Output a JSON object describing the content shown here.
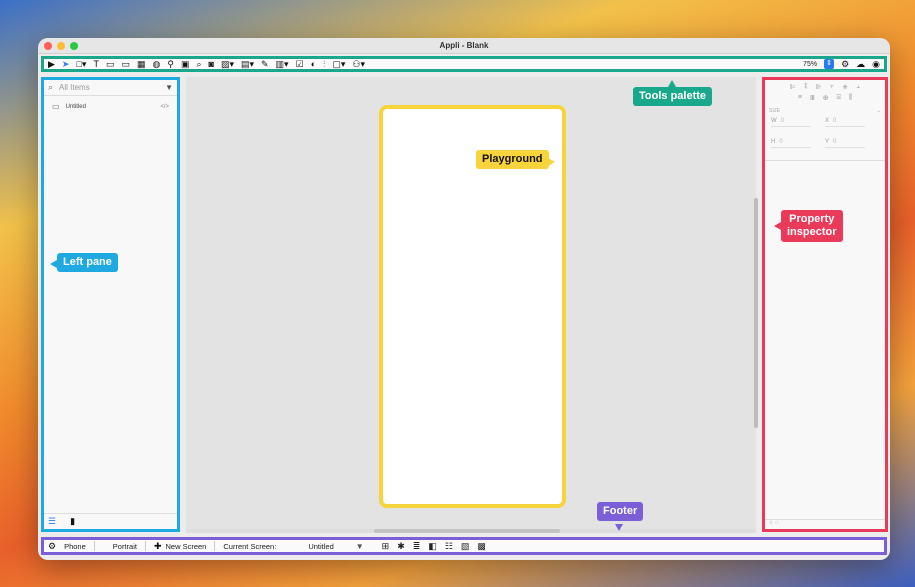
{
  "window": {
    "title": "Appli - Blank"
  },
  "toolbar": {
    "tools": [
      {
        "icon": "play-icon",
        "glyph": "▶"
      },
      {
        "icon": "pointer-icon",
        "glyph": "➤",
        "blue": true
      },
      {
        "icon": "rectangle-icon",
        "glyph": "□▾"
      },
      {
        "icon": "text-icon",
        "glyph": "T"
      },
      {
        "icon": "button-icon",
        "glyph": "▭"
      },
      {
        "icon": "input-icon",
        "glyph": "▭"
      },
      {
        "icon": "table-icon",
        "glyph": "▦"
      },
      {
        "icon": "globe-icon",
        "glyph": "◍"
      },
      {
        "icon": "map-pin-icon",
        "glyph": "⚲"
      },
      {
        "icon": "chart-icon",
        "glyph": "▣"
      },
      {
        "icon": "search-icon",
        "glyph": "⌕"
      },
      {
        "icon": "camera-icon",
        "glyph": "◙"
      },
      {
        "icon": "image-icon",
        "glyph": "▨▾"
      },
      {
        "icon": "list-icon",
        "glyph": "▤▾"
      },
      {
        "icon": "edit-icon",
        "glyph": "✎"
      },
      {
        "icon": "form-icon",
        "glyph": "▥▾"
      },
      {
        "icon": "checkbox-icon",
        "glyph": "☑"
      },
      {
        "icon": "toggle-icon",
        "glyph": "◐"
      },
      {
        "icon": "sliders-icon",
        "glyph": "⫶"
      },
      {
        "icon": "calendar-icon",
        "glyph": "▢▾"
      },
      {
        "icon": "user-icon",
        "glyph": "⚇▾"
      }
    ],
    "zoom": "75%",
    "right_icons": [
      "settings-icon",
      "cloud-upload-icon",
      "account-icon"
    ]
  },
  "left_pane": {
    "search_placeholder": "All Items",
    "items": [
      {
        "label": "Untitled",
        "code": "</>"
      }
    ]
  },
  "inspector": {
    "size_label": "SIZE",
    "fields": [
      {
        "label": "W",
        "value": "0"
      },
      {
        "label": "X",
        "value": "0"
      },
      {
        "label": "H",
        "value": "0"
      },
      {
        "label": "Y",
        "value": "0"
      }
    ]
  },
  "footer": {
    "device": "Phone",
    "orientation": "Portrait",
    "new_screen": "New Screen",
    "current_screen_label": "Current Screen:",
    "current_screen_value": "Untitled"
  },
  "callouts": {
    "tools_palette": "Tools palette",
    "playground": "Playground",
    "left_pane": "Left pane",
    "property_inspector_line1": "Property",
    "property_inspector_line2": "inspector",
    "footer": "Footer"
  }
}
